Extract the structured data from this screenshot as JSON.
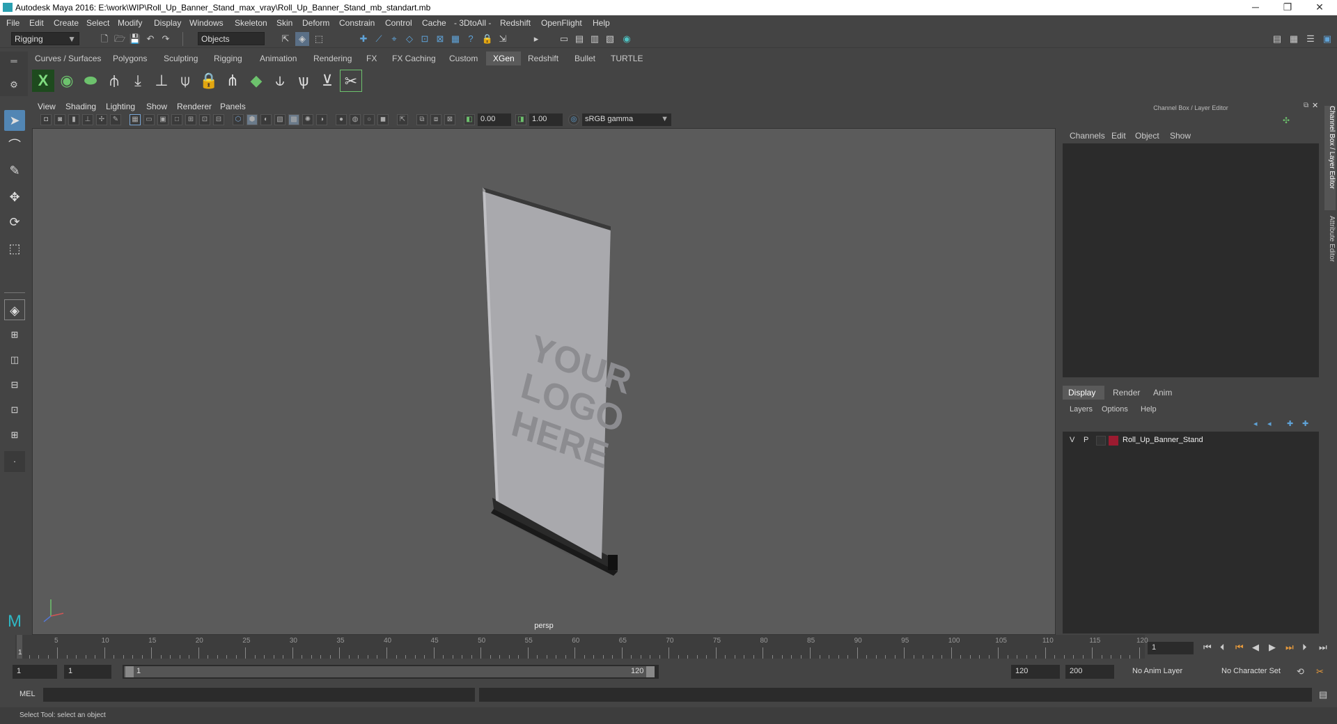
{
  "window": {
    "title": "Autodesk Maya 2016: E:\\work\\WIP\\Roll_Up_Banner_Stand_max_vray\\Roll_Up_Banner_Stand_mb_standart.mb",
    "minimize": "─",
    "restore": "❐",
    "close": "✕"
  },
  "menu": [
    "File",
    "Edit",
    "Create",
    "Select",
    "Modify",
    "Display",
    "Windows",
    "Skeleton",
    "Skin",
    "Deform",
    "Constrain",
    "Control",
    "Cache",
    "- 3DtoAll -",
    "Redshift",
    "OpenFlight",
    "Help"
  ],
  "status_line": {
    "menu_set": "Rigging",
    "selection_mode": "Objects"
  },
  "shelf_tabs": [
    "Curves / Surfaces",
    "Polygons",
    "Sculpting",
    "Rigging",
    "Animation",
    "Rendering",
    "FX",
    "FX Caching",
    "Custom",
    "XGen",
    "Redshift",
    "Bullet",
    "TURTLE"
  ],
  "shelf_active": "XGen",
  "viewport": {
    "menus": [
      "View",
      "Shading",
      "Lighting",
      "Show",
      "Renderer",
      "Panels"
    ],
    "exposure": "0.00",
    "gamma": "1.00",
    "color_space": "sRGB gamma",
    "camera": "persp",
    "banner_text": [
      "YOUR",
      "LOGO",
      "HERE"
    ]
  },
  "channel_box": {
    "title": "Channel Box / Layer Editor",
    "menus": [
      "Channels",
      "Edit",
      "Object",
      "Show"
    ],
    "layer_tabs": [
      "Display",
      "Render",
      "Anim"
    ],
    "active_layer_tab": "Display",
    "layer_menus": [
      "Layers",
      "Options",
      "Help"
    ],
    "layers": [
      {
        "v": "V",
        "p": "P",
        "color": "#9b1b30",
        "name": "Roll_Up_Banner_Stand"
      }
    ]
  },
  "side_tabs": [
    "Channel Box / Layer Editor",
    "Attribute Editor"
  ],
  "timeline": {
    "start": 1,
    "end": 120,
    "labels": [
      "5",
      "10",
      "15",
      "20",
      "25",
      "30",
      "35",
      "40",
      "45",
      "50",
      "55",
      "60",
      "65",
      "70",
      "75",
      "80",
      "85",
      "90",
      "95",
      "100",
      "105",
      "110",
      "115",
      "120"
    ],
    "current_frame": "1",
    "current_frame_marker": "1"
  },
  "range": {
    "start_field": "1",
    "playback_start": "1",
    "slider_start": "1",
    "slider_end": "120",
    "playback_end": "120",
    "end_field": "200",
    "anim_layer": "No Anim Layer",
    "character_set": "No Character Set"
  },
  "mel": {
    "label": "MEL"
  },
  "help_line": "Select Tool: select an object"
}
